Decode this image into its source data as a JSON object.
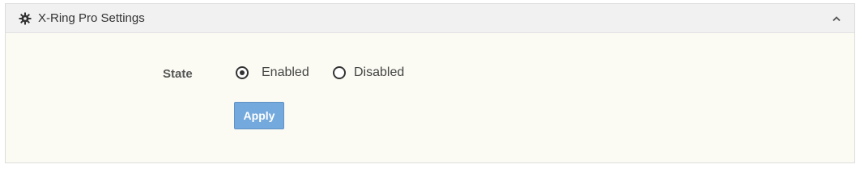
{
  "panel": {
    "title": "X-Ring Pro Settings",
    "header_icon": "gear-icon",
    "collapse_icon": "chevron-up-icon"
  },
  "form": {
    "state_label": "State",
    "options": [
      {
        "label": "Enabled",
        "selected": true
      },
      {
        "label": "Disabled",
        "selected": false
      }
    ],
    "apply_label": "Apply"
  },
  "colors": {
    "panel_bg": "#fbfbf3",
    "header_bg": "#f1f1f1",
    "button_bg": "#74a9dd"
  }
}
